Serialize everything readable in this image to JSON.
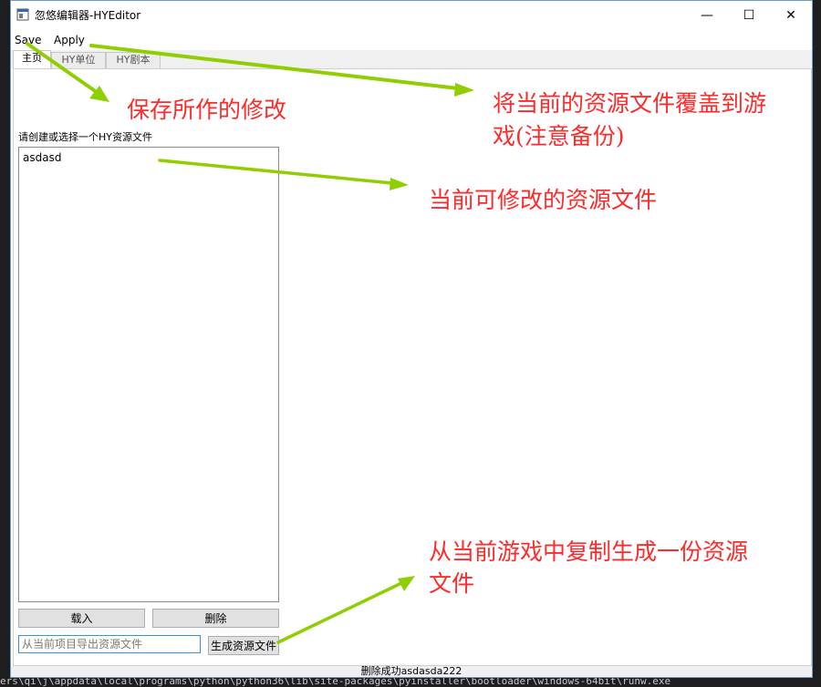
{
  "window": {
    "title": "忽悠编辑器-HYEditor",
    "minimize": "—",
    "maximize": "☐",
    "close": "✕"
  },
  "menu": {
    "save": "Save",
    "apply": "Apply"
  },
  "tabs": [
    {
      "label": "主页",
      "active": true
    },
    {
      "label": "HY单位",
      "active": false
    },
    {
      "label": "HY剧本",
      "active": false
    }
  ],
  "main": {
    "prompt": "请创建或选择一个HY资源文件",
    "files": [
      "asdasd"
    ],
    "load_button": "载入",
    "delete_button": "删除",
    "export_placeholder": "从当前项目导出资源文件",
    "generate_button": "生成资源文件"
  },
  "status": {
    "text": "删除成功asdasda222"
  },
  "background": {
    "terminal_line": "ers\\qi\\j\\appdata\\local\\programs\\python\\python36\\lib\\site-packages\\pyinstaller\\bootloader\\windows-64bit\\runw.exe"
  },
  "annotations": {
    "save": "保存所作的修改",
    "apply_line1": "将当前的资源文件覆盖到游",
    "apply_line2": "戏(注意备份)",
    "file": "当前可修改的资源文件",
    "generate_line1": "从当前游戏中复制生成一份资源",
    "generate_line2": "文件"
  },
  "colors": {
    "annotation_text": "#ff2a2a",
    "arrow": "#8fce00",
    "window_border": "#6d9ccf"
  }
}
